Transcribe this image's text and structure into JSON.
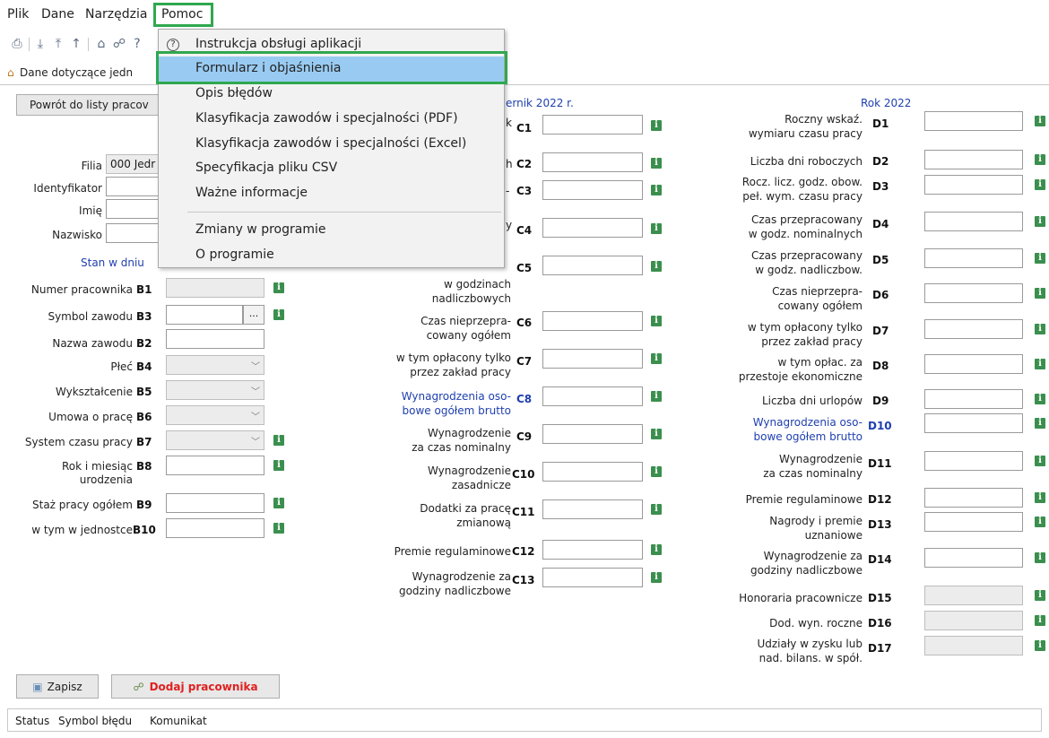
{
  "menubar": {
    "items": [
      "Plik",
      "Dane",
      "Narzędzia",
      "Pomoc"
    ]
  },
  "tab": {
    "label": "Dane dotyczące jedn"
  },
  "back_button": "Powrót do listy pracov",
  "dropdown": {
    "items": [
      "Instrukcja obsługi aplikacji",
      "Formularz i objaśnienia",
      "Opis błędów",
      "Klasyfikacja zawodów i specjalności (PDF)",
      "Klasyfikacja zawodów i specjalności (Excel)",
      "Specyfikacja pliku CSV",
      "Ważne informacje",
      "Zmiany w programie",
      "O programie"
    ]
  },
  "left": {
    "filia_label": "Filia",
    "filia_value": "000 Jedr",
    "identyfikator_label": "Identyfikator",
    "imie_label": "Imię",
    "nazwisko_label": "Nazwisko",
    "stan_label": "Stan w dniu",
    "rows": [
      {
        "label": "Numer pracownika",
        "code": "B1"
      },
      {
        "label": "Symbol zawodu",
        "code": "B3",
        "ellipsis": "..."
      },
      {
        "label": "Nazwa zawodu",
        "code": "B2"
      },
      {
        "label": "Płeć",
        "code": "B4"
      },
      {
        "label": "Wykształcenie",
        "code": "B5"
      },
      {
        "label": "Umowa o pracę",
        "code": "B6"
      },
      {
        "label": "System czasu pracy",
        "code": "B7"
      },
      {
        "label": "Rok i miesiąc",
        "label2": "urodzenia",
        "code": "B8"
      },
      {
        "label": "Staż pracy ogółem",
        "code": "B9"
      },
      {
        "label": "w tym w jednostce",
        "code": "B10"
      }
    ]
  },
  "mid": {
    "header": "ernik 2022 r.",
    "c1_frag": "k",
    "c2_frag": "h",
    "c3_frag": "-",
    "c4_frag": "y",
    "c5_label": "w godzinach",
    "c5_label2": "nadliczbowych",
    "rows": [
      {
        "code": "C1"
      },
      {
        "code": "C2"
      },
      {
        "code": "C3"
      },
      {
        "code": "C4"
      },
      {
        "code": "C5"
      },
      {
        "code": "C6",
        "l1": "Czas nieprzepra-",
        "l2": "cowany ogółem"
      },
      {
        "code": "C7",
        "l1": "w tym opłacony tylko",
        "l2": "przez zakład pracy"
      },
      {
        "code": "C8",
        "l1": "Wynagrodzenia oso-",
        "l2": "bowe ogółem brutto"
      },
      {
        "code": "C9",
        "l1": "Wynagrodzenie",
        "l2": "za czas nominalny"
      },
      {
        "code": "C10",
        "l1": "Wynagrodzenie",
        "l2": "zasadnicze"
      },
      {
        "code": "C11",
        "l1": "Dodatki za pracę",
        "l2": "zmianową"
      },
      {
        "code": "C12",
        "l1": "Premie regulaminowe"
      },
      {
        "code": "C13",
        "l1": "Wynagrodzenie za",
        "l2": "godziny nadliczbowe"
      }
    ]
  },
  "right": {
    "header": "Rok 2022",
    "rows": [
      {
        "code": "D1",
        "l1": "Roczny wskaź.",
        "l2": "wymiaru czasu pracy"
      },
      {
        "code": "D2",
        "l1": "Liczba dni roboczych"
      },
      {
        "code": "D3",
        "l1": "Rocz. licz. godz. obow.",
        "l2": "peł. wym. czasu pracy"
      },
      {
        "code": "D4",
        "l1": "Czas przepracowany",
        "l2": "w godz. nominalnych"
      },
      {
        "code": "D5",
        "l1": "Czas przepracowany",
        "l2": "w godz. nadliczbow."
      },
      {
        "code": "D6",
        "l1": "Czas nieprzepra-",
        "l2": "cowany ogółem"
      },
      {
        "code": "D7",
        "l1": "w tym opłacony tylko",
        "l2": "przez zakład pracy"
      },
      {
        "code": "D8",
        "l1": "w tym opłac. za",
        "l2": "przestoje ekonomiczne"
      },
      {
        "code": "D9",
        "l1": "Liczba dni urlopów"
      },
      {
        "code": "D10",
        "l1": "Wynagrodzenia oso-",
        "l2": "bowe ogółem brutto"
      },
      {
        "code": "D11",
        "l1": "Wynagrodzenie",
        "l2": "za czas nominalny"
      },
      {
        "code": "D12",
        "l1": "Premie regulaminowe"
      },
      {
        "code": "D13",
        "l1": "Nagrody i premie",
        "l2": "uznaniowe"
      },
      {
        "code": "D14",
        "l1": "Wynagrodzenie za",
        "l2": "godziny nadliczbowe"
      },
      {
        "code": "D15",
        "l1": "Honoraria pracownicze"
      },
      {
        "code": "D16",
        "l1": "Dod. wyn. roczne"
      },
      {
        "code": "D17",
        "l1": "Udziały w zysku lub",
        "l2": "nad. bilans. w spół."
      }
    ]
  },
  "buttons": {
    "save": "Zapisz",
    "add": "Dodaj pracownika"
  },
  "status_bar": {
    "columns": [
      "Status",
      "Symbol błędu",
      "Komunikat"
    ]
  },
  "info_glyph": "i",
  "colors": {
    "accent_green": "#2fa84f",
    "highlight": "#99cbf2",
    "label_blue": "#1f3fb0",
    "add_red": "#e02020"
  }
}
